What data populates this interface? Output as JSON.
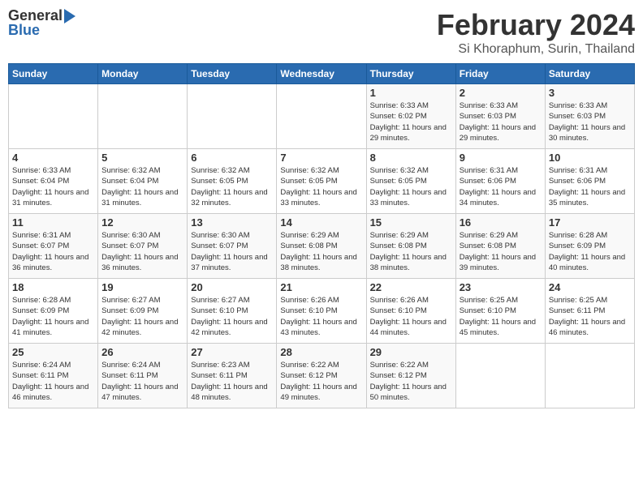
{
  "header": {
    "logo_line1": "General",
    "logo_line2": "Blue",
    "month": "February 2024",
    "location": "Si Khoraphum, Surin, Thailand"
  },
  "days_of_week": [
    "Sunday",
    "Monday",
    "Tuesday",
    "Wednesday",
    "Thursday",
    "Friday",
    "Saturday"
  ],
  "weeks": [
    [
      {
        "day": null
      },
      {
        "day": null
      },
      {
        "day": null
      },
      {
        "day": null
      },
      {
        "day": "1",
        "sunrise": "6:33 AM",
        "sunset": "6:02 PM",
        "daylight": "11 hours and 29 minutes."
      },
      {
        "day": "2",
        "sunrise": "6:33 AM",
        "sunset": "6:03 PM",
        "daylight": "11 hours and 29 minutes."
      },
      {
        "day": "3",
        "sunrise": "6:33 AM",
        "sunset": "6:03 PM",
        "daylight": "11 hours and 30 minutes."
      }
    ],
    [
      {
        "day": "4",
        "sunrise": "6:33 AM",
        "sunset": "6:04 PM",
        "daylight": "11 hours and 31 minutes."
      },
      {
        "day": "5",
        "sunrise": "6:32 AM",
        "sunset": "6:04 PM",
        "daylight": "11 hours and 31 minutes."
      },
      {
        "day": "6",
        "sunrise": "6:32 AM",
        "sunset": "6:05 PM",
        "daylight": "11 hours and 32 minutes."
      },
      {
        "day": "7",
        "sunrise": "6:32 AM",
        "sunset": "6:05 PM",
        "daylight": "11 hours and 33 minutes."
      },
      {
        "day": "8",
        "sunrise": "6:32 AM",
        "sunset": "6:05 PM",
        "daylight": "11 hours and 33 minutes."
      },
      {
        "day": "9",
        "sunrise": "6:31 AM",
        "sunset": "6:06 PM",
        "daylight": "11 hours and 34 minutes."
      },
      {
        "day": "10",
        "sunrise": "6:31 AM",
        "sunset": "6:06 PM",
        "daylight": "11 hours and 35 minutes."
      }
    ],
    [
      {
        "day": "11",
        "sunrise": "6:31 AM",
        "sunset": "6:07 PM",
        "daylight": "11 hours and 36 minutes."
      },
      {
        "day": "12",
        "sunrise": "6:30 AM",
        "sunset": "6:07 PM",
        "daylight": "11 hours and 36 minutes."
      },
      {
        "day": "13",
        "sunrise": "6:30 AM",
        "sunset": "6:07 PM",
        "daylight": "11 hours and 37 minutes."
      },
      {
        "day": "14",
        "sunrise": "6:29 AM",
        "sunset": "6:08 PM",
        "daylight": "11 hours and 38 minutes."
      },
      {
        "day": "15",
        "sunrise": "6:29 AM",
        "sunset": "6:08 PM",
        "daylight": "11 hours and 38 minutes."
      },
      {
        "day": "16",
        "sunrise": "6:29 AM",
        "sunset": "6:08 PM",
        "daylight": "11 hours and 39 minutes."
      },
      {
        "day": "17",
        "sunrise": "6:28 AM",
        "sunset": "6:09 PM",
        "daylight": "11 hours and 40 minutes."
      }
    ],
    [
      {
        "day": "18",
        "sunrise": "6:28 AM",
        "sunset": "6:09 PM",
        "daylight": "11 hours and 41 minutes."
      },
      {
        "day": "19",
        "sunrise": "6:27 AM",
        "sunset": "6:09 PM",
        "daylight": "11 hours and 42 minutes."
      },
      {
        "day": "20",
        "sunrise": "6:27 AM",
        "sunset": "6:10 PM",
        "daylight": "11 hours and 42 minutes."
      },
      {
        "day": "21",
        "sunrise": "6:26 AM",
        "sunset": "6:10 PM",
        "daylight": "11 hours and 43 minutes."
      },
      {
        "day": "22",
        "sunrise": "6:26 AM",
        "sunset": "6:10 PM",
        "daylight": "11 hours and 44 minutes."
      },
      {
        "day": "23",
        "sunrise": "6:25 AM",
        "sunset": "6:10 PM",
        "daylight": "11 hours and 45 minutes."
      },
      {
        "day": "24",
        "sunrise": "6:25 AM",
        "sunset": "6:11 PM",
        "daylight": "11 hours and 46 minutes."
      }
    ],
    [
      {
        "day": "25",
        "sunrise": "6:24 AM",
        "sunset": "6:11 PM",
        "daylight": "11 hours and 46 minutes."
      },
      {
        "day": "26",
        "sunrise": "6:24 AM",
        "sunset": "6:11 PM",
        "daylight": "11 hours and 47 minutes."
      },
      {
        "day": "27",
        "sunrise": "6:23 AM",
        "sunset": "6:11 PM",
        "daylight": "11 hours and 48 minutes."
      },
      {
        "day": "28",
        "sunrise": "6:22 AM",
        "sunset": "6:12 PM",
        "daylight": "11 hours and 49 minutes."
      },
      {
        "day": "29",
        "sunrise": "6:22 AM",
        "sunset": "6:12 PM",
        "daylight": "11 hours and 50 minutes."
      },
      {
        "day": null
      },
      {
        "day": null
      }
    ]
  ]
}
